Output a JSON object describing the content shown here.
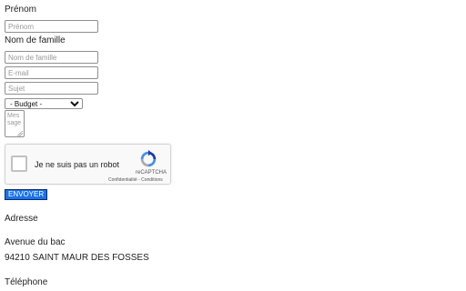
{
  "form": {
    "prenom_label": "Prénom",
    "prenom_placeholder": "Prénom",
    "nom_label": "Nom de famille",
    "nom_placeholder": "Nom de famille",
    "email_placeholder": "E-mail",
    "sujet_placeholder": "Sujet",
    "budget_selected": "- Budget -",
    "message_placeholder": "Message",
    "submit_label": "ENVOYER"
  },
  "captcha": {
    "checkbox_text": "Je ne suis pas un robot",
    "brand": "reCAPTCHA",
    "links": "Confidentialité - Conditions"
  },
  "contact": {
    "address_heading": "Adresse",
    "street": "Avenue du bac",
    "city": "94210 SAINT MAUR DES FOSSES",
    "phone_heading": "Téléphone"
  },
  "colors": {
    "button_bg": "#1a73e8",
    "recaptcha_blue": "#1c3aa9",
    "recaptcha_light": "#4a90e2"
  }
}
